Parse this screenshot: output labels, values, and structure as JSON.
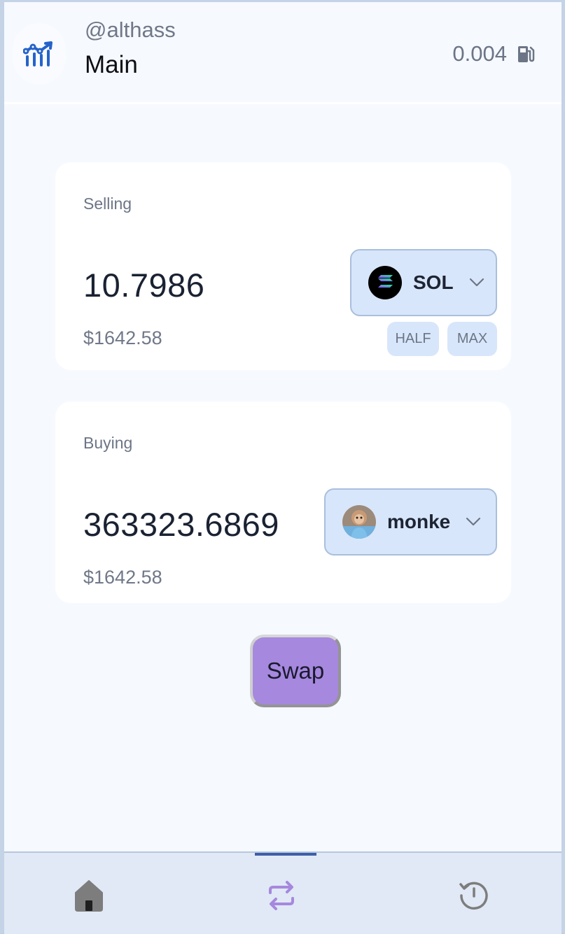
{
  "header": {
    "handle": "@althass",
    "wallet_name": "Main",
    "gas_value": "0.004",
    "logo_icon": "chart-growth-icon",
    "gas_icon": "gas-pump-icon"
  },
  "selling": {
    "label": "Selling",
    "amount": "10.7986",
    "usd_value": "$1642.58",
    "token": "SOL",
    "token_icon": "solana-logo-icon",
    "half_label": "HALF",
    "max_label": "MAX"
  },
  "buying": {
    "label": "Buying",
    "amount": "363323.6869",
    "usd_value": "$1642.58",
    "token": "monke",
    "token_icon": "monke-avatar-icon"
  },
  "swap": {
    "label": "Swap"
  },
  "nav": {
    "items": [
      {
        "name": "home",
        "icon": "home-icon"
      },
      {
        "name": "swap",
        "icon": "swap-arrows-icon",
        "active": true
      },
      {
        "name": "history",
        "icon": "history-icon"
      }
    ]
  },
  "colors": {
    "accent": "#a688de",
    "active_nav": "#3e5ea8",
    "token_button": "#d8e6fb",
    "logo_blue": "#2563c9"
  }
}
